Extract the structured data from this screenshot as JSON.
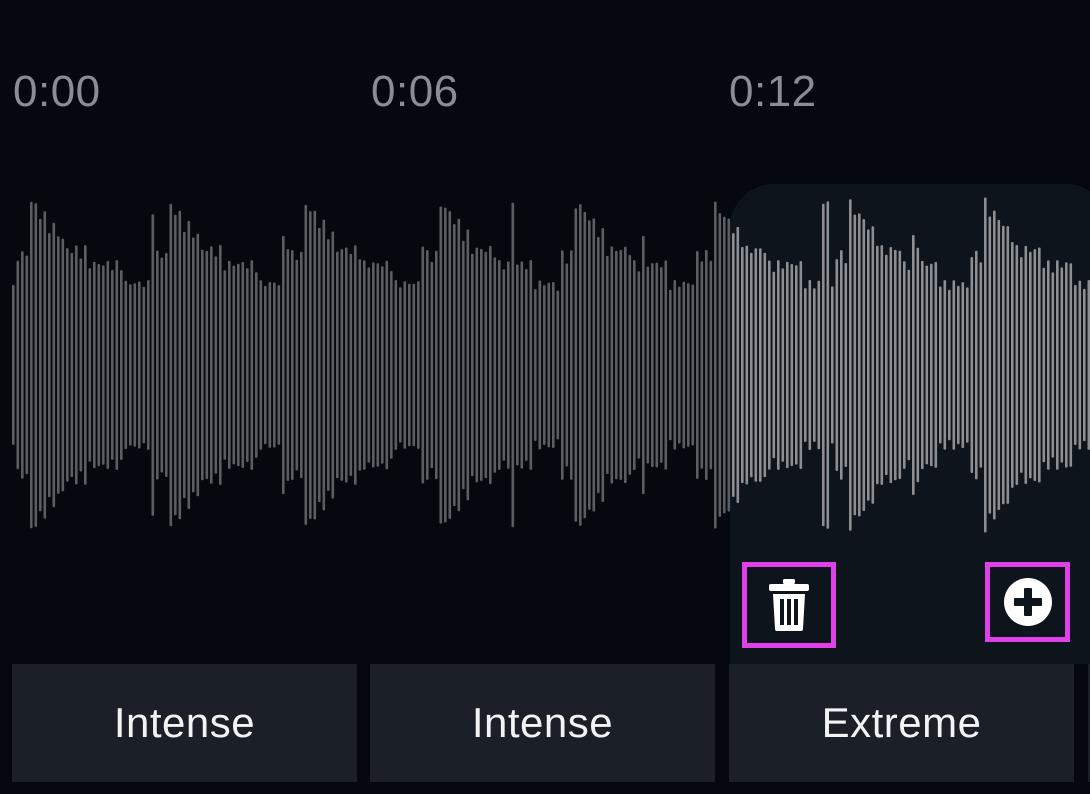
{
  "timeline": {
    "ticks": [
      "0:00",
      "0:06",
      "0:12"
    ]
  },
  "waveform": {
    "color": "#5a5d62",
    "selected_color": "#8c8e92"
  },
  "selection": {
    "delete_icon": "trash-icon",
    "add_icon": "plus-circle-icon",
    "highlight_color": "#e040e8"
  },
  "segments": [
    {
      "label": "Intense"
    },
    {
      "label": "Intense"
    },
    {
      "label": "Extreme"
    },
    {
      "label": ""
    }
  ]
}
